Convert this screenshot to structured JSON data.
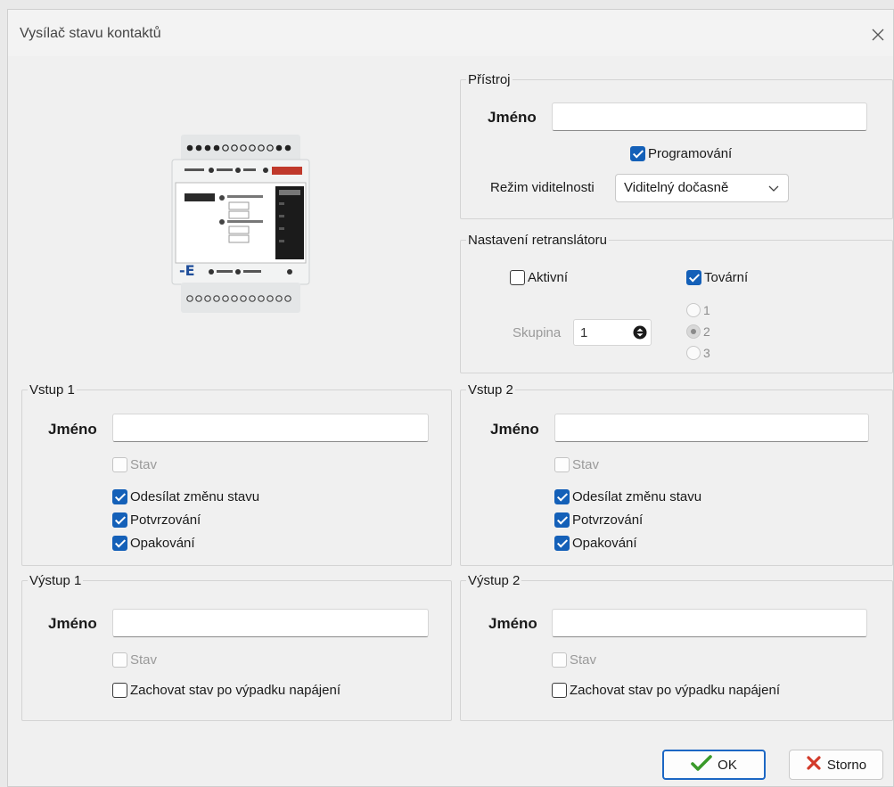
{
  "window": {
    "title": "Vysílač stavu kontaktů"
  },
  "device": {
    "legend": "Přístroj",
    "name_label": "Jméno",
    "name_value": "",
    "programming_label": "Programování",
    "programming_checked": true,
    "visibility_label": "Režim viditelnosti",
    "visibility_value": "Viditelný dočasně"
  },
  "repeater": {
    "legend": "Nastavení retranslátoru",
    "active_label": "Aktivní",
    "active_checked": false,
    "factory_label": "Tovární",
    "factory_checked": true,
    "group_label": "Skupina",
    "group_value": "1",
    "options": [
      "1",
      "2",
      "3"
    ],
    "selected_option": "2"
  },
  "input1": {
    "legend": "Vstup 1",
    "name_label": "Jméno",
    "state_label": "Stav",
    "send_change_label": "Odesílat změnu stavu",
    "confirm_label": "Potvrzování",
    "repeat_label": "Opakování"
  },
  "input2": {
    "legend": "Vstup 2",
    "name_label": "Jméno",
    "state_label": "Stav",
    "send_change_label": "Odesílat změnu stavu",
    "confirm_label": "Potvrzování",
    "repeat_label": "Opakování"
  },
  "output1": {
    "legend": "Výstup 1",
    "name_label": "Jméno",
    "state_label": "Stav",
    "keep_state_label": "Zachovat stav po výpadku napájení"
  },
  "output2": {
    "legend": "Výstup 2",
    "name_label": "Jméno",
    "state_label": "Stav",
    "keep_state_label": "Zachovat stav po výpadku napájení"
  },
  "buttons": {
    "ok_label": "OK",
    "cancel_label": "Storno"
  },
  "colors": {
    "accent": "#1460b8",
    "ok_icon": "#3a9a2a",
    "cancel_icon": "#d23a2a"
  },
  "icons": [
    "close-icon",
    "chevron-down-icon",
    "checkmark-icon",
    "cross-icon",
    "spinner-arrows-icon"
  ]
}
